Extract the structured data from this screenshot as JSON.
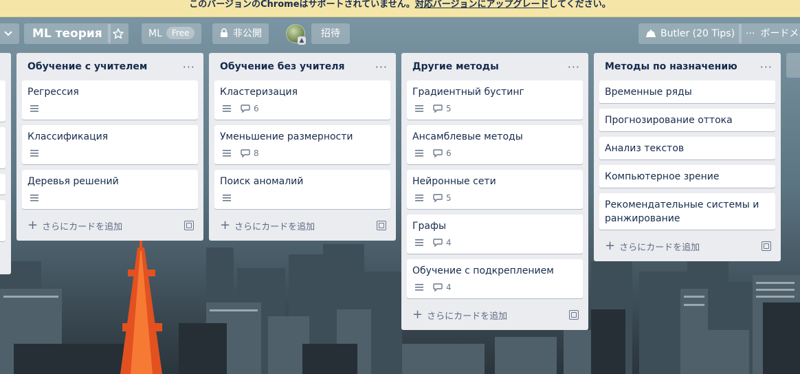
{
  "banner": {
    "text_before": "このバージョンのChromeはサポートされていません。",
    "link": "対応バージョンにアップグレード",
    "text_after": "してください。"
  },
  "header": {
    "board_title": "ML теория",
    "workspace_name": "ML",
    "workspace_plan": "Free",
    "visibility": "非公開",
    "invite": "招待",
    "butler": "Butler (20 Tips)",
    "board_menu": "ボードメニ"
  },
  "add_card_label": "さらにカードを追加",
  "lists": [
    {
      "title": "Обучение с учителем",
      "cards": [
        {
          "title": "Регрессия",
          "description": true,
          "comments": null
        },
        {
          "title": "Классификация",
          "description": true,
          "comments": null
        },
        {
          "title": "Деревья решений",
          "description": true,
          "comments": null
        }
      ]
    },
    {
      "title": "Обучение без учителя",
      "cards": [
        {
          "title": "Кластеризация",
          "description": true,
          "comments": "6"
        },
        {
          "title": "Уменьшение размерности",
          "description": true,
          "comments": "8"
        },
        {
          "title": "Поиск аномалий",
          "description": true,
          "comments": null
        }
      ]
    },
    {
      "title": "Другие методы",
      "cards": [
        {
          "title": "Градиентный бустинг",
          "description": true,
          "comments": "5"
        },
        {
          "title": "Ансамблевые методы",
          "description": true,
          "comments": "6"
        },
        {
          "title": "Нейронные сети",
          "description": true,
          "comments": "5"
        },
        {
          "title": "Графы",
          "description": true,
          "comments": "4"
        },
        {
          "title": "Обучение с подкреплением",
          "description": true,
          "comments": "4"
        }
      ]
    },
    {
      "title": "Методы по назначению",
      "cards": [
        {
          "title": "Временные ряды"
        },
        {
          "title": "Прогнозирование оттока"
        },
        {
          "title": "Анализ текстов"
        },
        {
          "title": "Компьютерное зрение"
        },
        {
          "title": "Рекомендательные системы и ранжирование"
        }
      ]
    }
  ]
}
